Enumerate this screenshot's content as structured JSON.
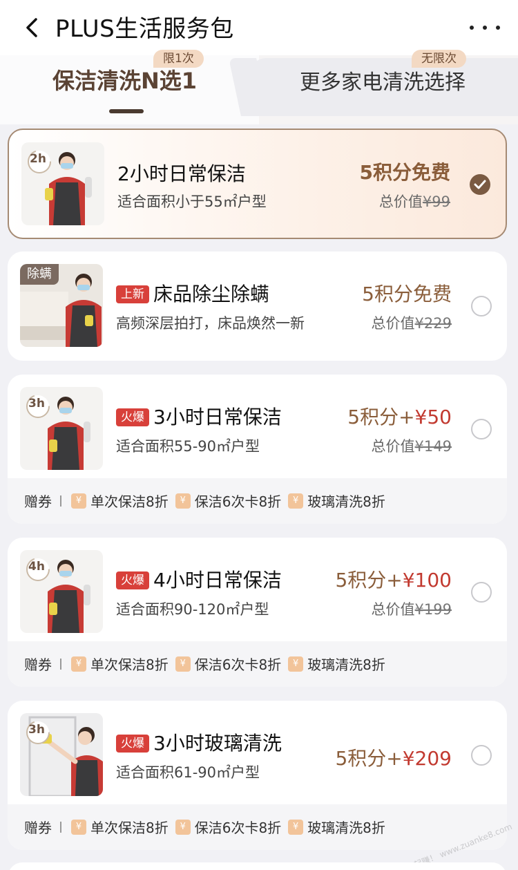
{
  "header": {
    "title": "PLUS生活服务包",
    "back_icon": "back-arrow-icon",
    "more_icon": "more-dots-icon"
  },
  "tabs": [
    {
      "label": "保洁清洗N选1",
      "badge": "限1次",
      "active": true
    },
    {
      "label": "更多家电清洗选择",
      "badge": "无限次",
      "active": false
    }
  ],
  "voucher": {
    "label": "赠券",
    "items": [
      "单次保洁8折",
      "保洁6次卡8折",
      "玻璃清洗8折"
    ]
  },
  "services": [
    {
      "badge": "2h",
      "tag": "",
      "title": "2小时日常保洁",
      "desc": "适合面积小于55㎡户型",
      "price_main": "5积分免费",
      "price_extra": "",
      "orig_label": "总价值",
      "orig_price": "¥99",
      "selected": true
    },
    {
      "badge": "",
      "thumb_tag": "除螨",
      "tag": "上新",
      "title": "床品除尘除螨",
      "desc": "高频深层拍打，床品焕然一新",
      "price_main": "5积分免费",
      "price_extra": "",
      "orig_label": "总价值",
      "orig_price": "¥229",
      "selected": false
    },
    {
      "badge": "3h",
      "tag": "火爆",
      "title": "3小时日常保洁",
      "desc": "适合面积55-90㎡户型",
      "price_main": "5积分+",
      "price_extra": "¥50",
      "orig_label": "总价值",
      "orig_price": "¥149",
      "selected": false
    },
    {
      "badge": "4h",
      "tag": "火爆",
      "title": "4小时日常保洁",
      "desc": "适合面积90-120㎡户型",
      "price_main": "5积分+",
      "price_extra": "¥100",
      "orig_label": "总价值",
      "orig_price": "¥199",
      "selected": false
    },
    {
      "badge": "3h",
      "tag": "火爆",
      "title": "3小时玻璃清洗",
      "desc": "适合面积61-90㎡户型",
      "price_main": "5积分+",
      "price_extra": "¥209",
      "orig_label": "",
      "orig_price": "",
      "selected": false
    }
  ],
  "watermark": "赚客吧，有奖一起赚！ www.zuanke8.com",
  "colors": {
    "accent_brown": "#7a5a42",
    "label_red": "#d8403a",
    "price_brown": "#8a5d3a",
    "price_red": "#c23a30"
  }
}
